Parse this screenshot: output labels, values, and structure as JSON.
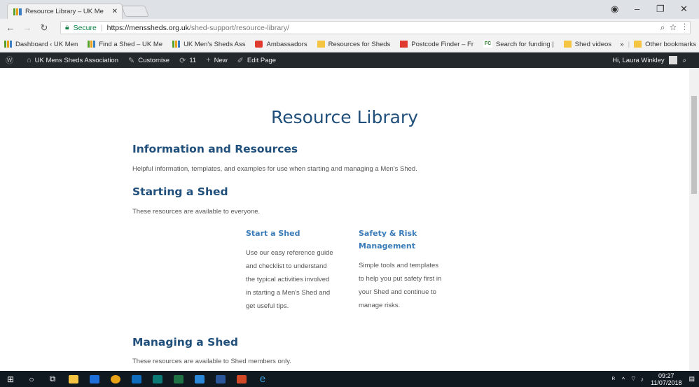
{
  "browser": {
    "tab_title": "Resource Library – UK Me",
    "secure_label": "Secure",
    "url_host": "https://menssheds.org.uk",
    "url_path": "/shed-support/resource-library/",
    "bookmarks": [
      {
        "label": "Dashboard ‹ UK Men",
        "icon": "bars"
      },
      {
        "label": "Find a Shed – UK Me",
        "icon": "bars"
      },
      {
        "label": "UK Men's Sheds Ass",
        "icon": "bars"
      },
      {
        "label": "Ambassadors",
        "icon": "red"
      },
      {
        "label": "Resources for Sheds",
        "icon": "folder"
      },
      {
        "label": "Postcode Finder – Fr",
        "icon": "redcross"
      },
      {
        "label": "Search for funding |",
        "icon": "fc"
      },
      {
        "label": "Shed videos",
        "icon": "folder"
      }
    ],
    "more_bookmarks": "»",
    "other_bookmarks": "Other bookmarks"
  },
  "adminbar": {
    "site_name": "UK Mens Sheds Association",
    "customise": "Customise",
    "updates": "11",
    "new": "New",
    "edit_page": "Edit Page",
    "greeting": "Hi, Laura Winkley"
  },
  "page": {
    "title": "Resource Library",
    "info_heading": "Information and Resources",
    "info_text": "Helpful information, templates, and examples for use when starting and managing a Men's Shed.",
    "starting_heading": "Starting a Shed",
    "starting_text": "These resources are available to everyone.",
    "cards": [
      {
        "title_lines": [
          "Start a Shed"
        ],
        "body_lines": [
          "Use our easy reference guide",
          "and checklist to understand",
          "the typical activities involved",
          "in starting a Men's Shed and",
          "get useful tips."
        ]
      },
      {
        "title_lines": [
          "Safety & Risk",
          "Management"
        ],
        "body_lines": [
          "Simple tools and templates",
          "to help you put safety first in",
          "your Shed and continue to",
          "manage risks."
        ]
      }
    ],
    "managing_heading": "Managing a Shed",
    "managing_text": "These resources are available to Shed members only."
  },
  "taskbar": {
    "time": "09:27",
    "date": "11/07/2018"
  }
}
